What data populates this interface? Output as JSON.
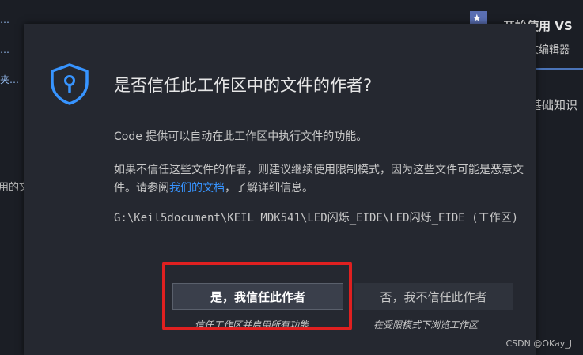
{
  "background": {
    "left_items": [
      "…",
      "…",
      "夹…",
      "用的文"
    ],
    "right_title": "开始使用 VS",
    "right_subtitle": "文编辑器",
    "right_section": "基础知识"
  },
  "dialog": {
    "title": "是否信任此工作区中的文件的作者?",
    "paragraph1": "Code 提供可以自动在此工作区中执行文件的功能。",
    "paragraph2_pre": "如果不信任这些文件的作者，则建议继续使用限制模式，因为这些文件可能是恶意文件。请参阅",
    "docs_link": "我们的文档",
    "paragraph2_post": "，了解详细信息。",
    "workspace_path": "G:\\Keil5document\\KEIL MDK541\\LED闪烁_EIDE\\LED闪烁_EIDE (工作区)",
    "trust_button": "是，我信任此作者",
    "trust_hint": "信任工作区并启用所有功能",
    "distrust_button": "否，我不信任此作者",
    "distrust_hint": "在受限模式下浏览工作区"
  },
  "watermark": "CSDN @OKay_J",
  "colors": {
    "accent_link": "#3794ff",
    "shield": "#3794ff",
    "highlight": "#e02020"
  }
}
